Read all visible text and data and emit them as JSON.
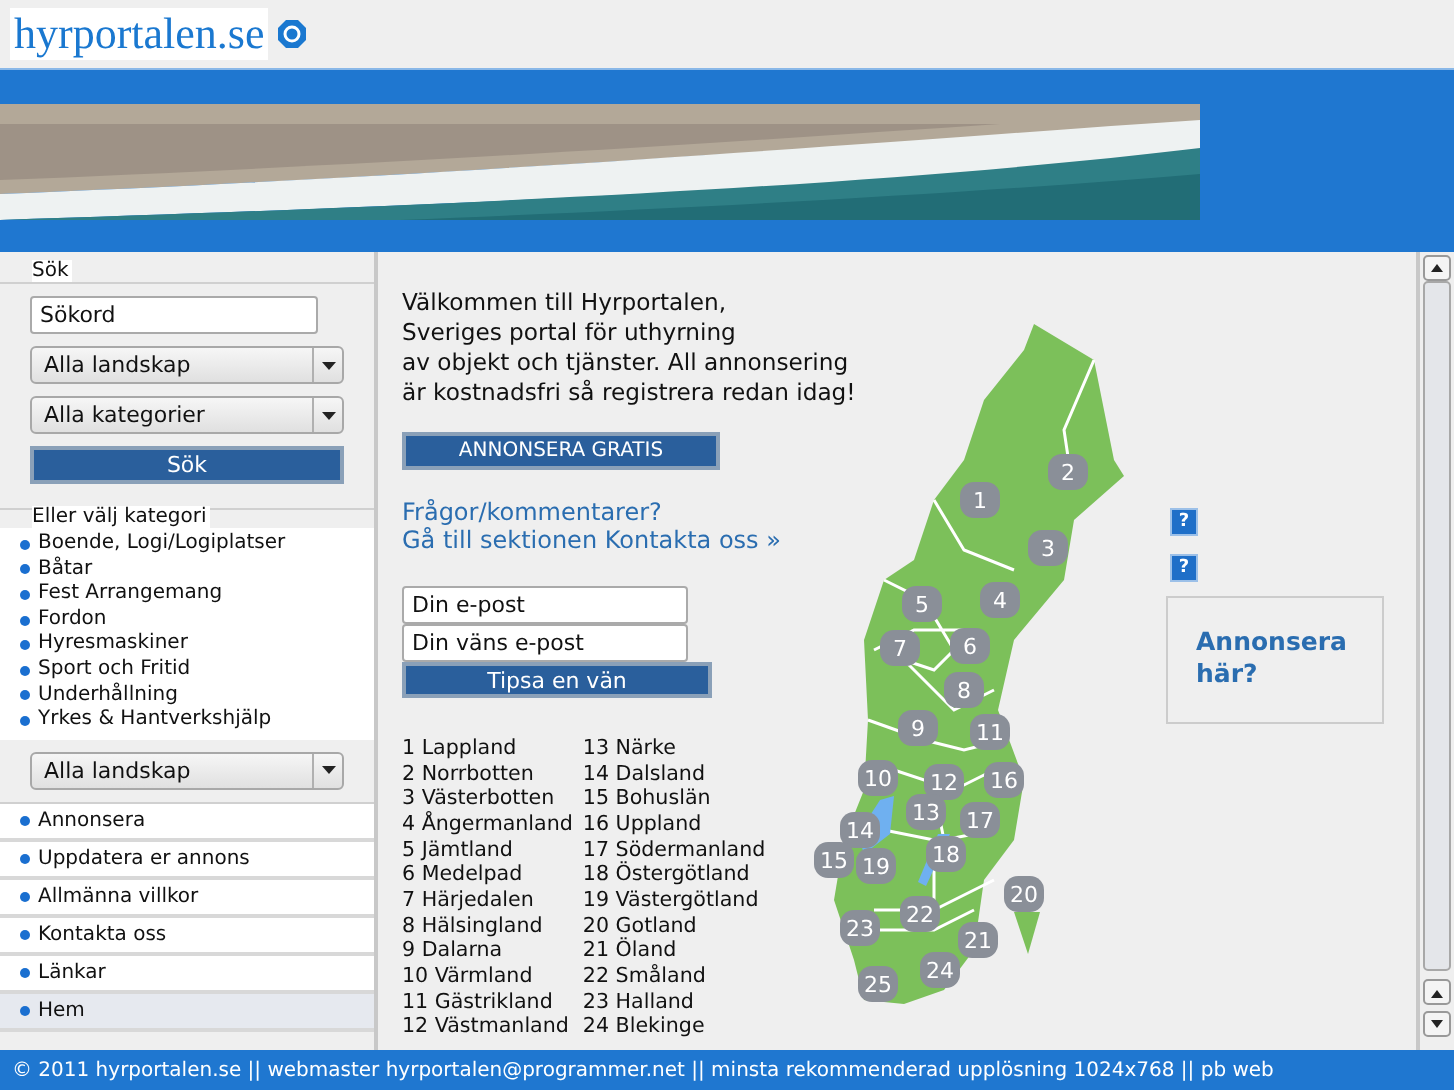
{
  "header": {
    "logo": "hyrportalen.se"
  },
  "sidebar": {
    "search_label": "Sök",
    "search_field": {
      "value": "Sökord"
    },
    "region_select": "Alla landskap",
    "category_select": "Alla kategorier",
    "search_button": "Sök",
    "category_label": "Eller välj kategori",
    "categories": [
      "Boende, Logi/Logiplatser",
      "Båtar",
      "Fest Arrangemang",
      "Fordon",
      "Hyresmaskiner",
      "Sport och Fritid",
      "Underhållning",
      "Yrkes & Hantverkshjälp"
    ],
    "region_select_2": "Alla landskap",
    "nav": [
      {
        "label": "Annonsera",
        "selected": false
      },
      {
        "label": "Uppdatera er annons",
        "selected": false
      },
      {
        "label": "Allmänna villkor",
        "selected": false
      },
      {
        "label": "Kontakta oss",
        "selected": false
      },
      {
        "label": "Länkar",
        "selected": false
      },
      {
        "label": "Hem",
        "selected": true
      }
    ]
  },
  "main": {
    "welcome": [
      "Välkommen till Hyrportalen,",
      "Sveriges portal för uthyrning",
      "av objekt och tjänster. All annonsering",
      "är kostnadsfri så registrera redan idag!"
    ],
    "advertise_button": "ANNONSERA GRATIS",
    "contact_links": [
      "Frågor/kommentarer?",
      "Gå till sektionen Kontakta oss »"
    ],
    "email_field": {
      "value": "Din e-post"
    },
    "friend_email_field": {
      "value": "Din väns e-post"
    },
    "tip_button": "Tipsa en vän",
    "regions_col_1": [
      "1 Lappland",
      "2 Norrbotten",
      "3 Västerbotten",
      "4 Ångermanland",
      "5 Jämtland",
      "6 Medelpad",
      "7 Härjedalen",
      "8 Hälsingland",
      "9 Dalarna",
      "10 Värmland",
      "11 Gästrikland",
      "12 Västmanland"
    ],
    "regions_col_2": [
      "13 Närke",
      "14 Dalsland",
      "15 Bohuslän",
      "16 Uppland",
      "17 Södermanland",
      "18 Östergötland",
      "19 Västergötland",
      "20 Gotland",
      "21 Öland",
      "22 Småland",
      "23 Halland",
      "24 Blekinge"
    ],
    "map_markers": [
      "1",
      "2",
      "3",
      "4",
      "5",
      "6",
      "7",
      "8",
      "9",
      "10",
      "11",
      "12",
      "13",
      "14",
      "15",
      "16",
      "17",
      "18",
      "19",
      "20",
      "21",
      "22",
      "23",
      "24",
      "25"
    ]
  },
  "right": {
    "help_icons": [
      "?",
      "?"
    ],
    "ad_box": "Annonsera här?"
  },
  "footer": "© 2011 hyrportalen.se || webmaster hyrportalen@programmer.net || minsta rekommenderad upplösning 1024x768 || pb web"
}
